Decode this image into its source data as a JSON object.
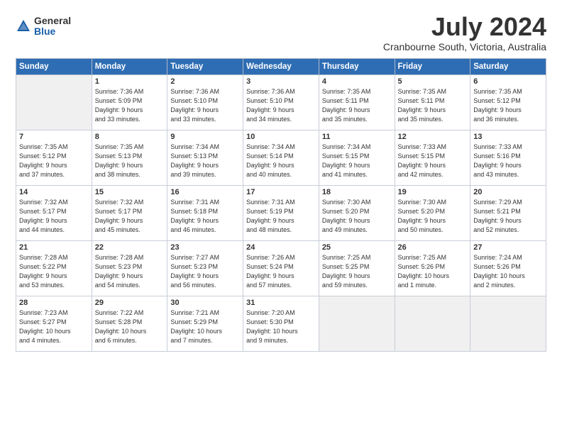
{
  "header": {
    "logo_general": "General",
    "logo_blue": "Blue",
    "title": "July 2024",
    "location": "Cranbourne South, Victoria, Australia"
  },
  "weekdays": [
    "Sunday",
    "Monday",
    "Tuesday",
    "Wednesday",
    "Thursday",
    "Friday",
    "Saturday"
  ],
  "weeks": [
    [
      {
        "day": "",
        "info": ""
      },
      {
        "day": "1",
        "info": "Sunrise: 7:36 AM\nSunset: 5:09 PM\nDaylight: 9 hours\nand 33 minutes."
      },
      {
        "day": "2",
        "info": "Sunrise: 7:36 AM\nSunset: 5:10 PM\nDaylight: 9 hours\nand 33 minutes."
      },
      {
        "day": "3",
        "info": "Sunrise: 7:36 AM\nSunset: 5:10 PM\nDaylight: 9 hours\nand 34 minutes."
      },
      {
        "day": "4",
        "info": "Sunrise: 7:35 AM\nSunset: 5:11 PM\nDaylight: 9 hours\nand 35 minutes."
      },
      {
        "day": "5",
        "info": "Sunrise: 7:35 AM\nSunset: 5:11 PM\nDaylight: 9 hours\nand 35 minutes."
      },
      {
        "day": "6",
        "info": "Sunrise: 7:35 AM\nSunset: 5:12 PM\nDaylight: 9 hours\nand 36 minutes."
      }
    ],
    [
      {
        "day": "7",
        "info": "Sunrise: 7:35 AM\nSunset: 5:12 PM\nDaylight: 9 hours\nand 37 minutes."
      },
      {
        "day": "8",
        "info": "Sunrise: 7:35 AM\nSunset: 5:13 PM\nDaylight: 9 hours\nand 38 minutes."
      },
      {
        "day": "9",
        "info": "Sunrise: 7:34 AM\nSunset: 5:13 PM\nDaylight: 9 hours\nand 39 minutes."
      },
      {
        "day": "10",
        "info": "Sunrise: 7:34 AM\nSunset: 5:14 PM\nDaylight: 9 hours\nand 40 minutes."
      },
      {
        "day": "11",
        "info": "Sunrise: 7:34 AM\nSunset: 5:15 PM\nDaylight: 9 hours\nand 41 minutes."
      },
      {
        "day": "12",
        "info": "Sunrise: 7:33 AM\nSunset: 5:15 PM\nDaylight: 9 hours\nand 42 minutes."
      },
      {
        "day": "13",
        "info": "Sunrise: 7:33 AM\nSunset: 5:16 PM\nDaylight: 9 hours\nand 43 minutes."
      }
    ],
    [
      {
        "day": "14",
        "info": "Sunrise: 7:32 AM\nSunset: 5:17 PM\nDaylight: 9 hours\nand 44 minutes."
      },
      {
        "day": "15",
        "info": "Sunrise: 7:32 AM\nSunset: 5:17 PM\nDaylight: 9 hours\nand 45 minutes."
      },
      {
        "day": "16",
        "info": "Sunrise: 7:31 AM\nSunset: 5:18 PM\nDaylight: 9 hours\nand 46 minutes."
      },
      {
        "day": "17",
        "info": "Sunrise: 7:31 AM\nSunset: 5:19 PM\nDaylight: 9 hours\nand 48 minutes."
      },
      {
        "day": "18",
        "info": "Sunrise: 7:30 AM\nSunset: 5:20 PM\nDaylight: 9 hours\nand 49 minutes."
      },
      {
        "day": "19",
        "info": "Sunrise: 7:30 AM\nSunset: 5:20 PM\nDaylight: 9 hours\nand 50 minutes."
      },
      {
        "day": "20",
        "info": "Sunrise: 7:29 AM\nSunset: 5:21 PM\nDaylight: 9 hours\nand 52 minutes."
      }
    ],
    [
      {
        "day": "21",
        "info": "Sunrise: 7:28 AM\nSunset: 5:22 PM\nDaylight: 9 hours\nand 53 minutes."
      },
      {
        "day": "22",
        "info": "Sunrise: 7:28 AM\nSunset: 5:23 PM\nDaylight: 9 hours\nand 54 minutes."
      },
      {
        "day": "23",
        "info": "Sunrise: 7:27 AM\nSunset: 5:23 PM\nDaylight: 9 hours\nand 56 minutes."
      },
      {
        "day": "24",
        "info": "Sunrise: 7:26 AM\nSunset: 5:24 PM\nDaylight: 9 hours\nand 57 minutes."
      },
      {
        "day": "25",
        "info": "Sunrise: 7:25 AM\nSunset: 5:25 PM\nDaylight: 9 hours\nand 59 minutes."
      },
      {
        "day": "26",
        "info": "Sunrise: 7:25 AM\nSunset: 5:26 PM\nDaylight: 10 hours\nand 1 minute."
      },
      {
        "day": "27",
        "info": "Sunrise: 7:24 AM\nSunset: 5:26 PM\nDaylight: 10 hours\nand 2 minutes."
      }
    ],
    [
      {
        "day": "28",
        "info": "Sunrise: 7:23 AM\nSunset: 5:27 PM\nDaylight: 10 hours\nand 4 minutes."
      },
      {
        "day": "29",
        "info": "Sunrise: 7:22 AM\nSunset: 5:28 PM\nDaylight: 10 hours\nand 6 minutes."
      },
      {
        "day": "30",
        "info": "Sunrise: 7:21 AM\nSunset: 5:29 PM\nDaylight: 10 hours\nand 7 minutes."
      },
      {
        "day": "31",
        "info": "Sunrise: 7:20 AM\nSunset: 5:30 PM\nDaylight: 10 hours\nand 9 minutes."
      },
      {
        "day": "",
        "info": ""
      },
      {
        "day": "",
        "info": ""
      },
      {
        "day": "",
        "info": ""
      }
    ]
  ]
}
